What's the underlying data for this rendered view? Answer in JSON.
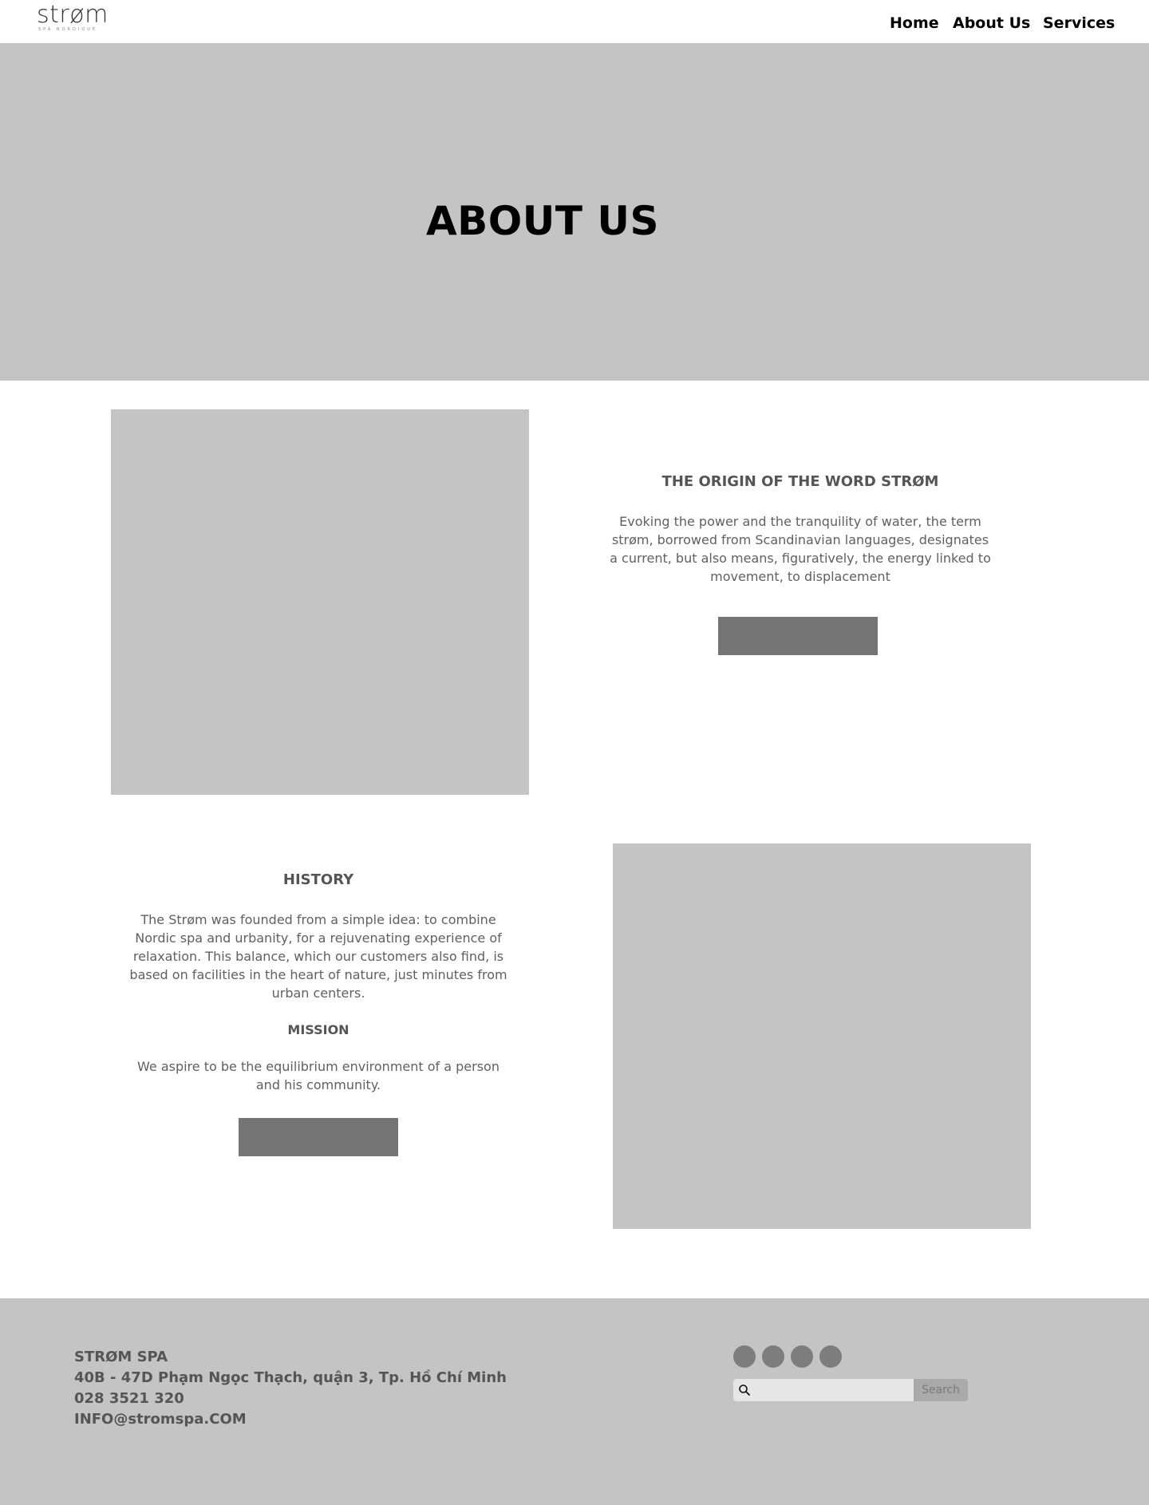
{
  "header": {
    "logo_word": "strøm",
    "logo_sub": "SPA NORDIQUE",
    "nav": {
      "home": "Home",
      "about": "About Us",
      "services": "Services"
    }
  },
  "hero": {
    "title": "ABOUT US"
  },
  "origin": {
    "heading": "THE ORIGIN OF THE WORD STRØM",
    "text": "Evoking the power and the tranquility of water, the term strøm, borrowed from Scandinavian languages, designates a current, but also means, figuratively, the energy linked to movement, to displacement"
  },
  "history": {
    "heading": "HISTORY",
    "text": "The Strøm was founded from a simple idea: to combine Nordic spa and urbanity, for a rejuvenating experience of relaxation. This balance, which our customers also find, is based on facilities in the heart of nature, just minutes from urban centers.",
    "mission_heading": "MISSION",
    "mission_text": "We aspire to be the equilibrium environment of a person and his community."
  },
  "footer": {
    "name": "STRØM SPA",
    "address": "40B - 47D Phạm Ngọc Thạch, quận 3, Tp. Hồ Chí Minh",
    "phone": "028 3521 320",
    "email": "INFO@stromspa.COM",
    "search_placeholder": "",
    "search_button": "Search"
  },
  "colors": {
    "placeholder_gray": "#c4c4c4",
    "button_gray": "#747474",
    "social_dot": "#7d7d7d"
  },
  "icons": {
    "search": "search-icon",
    "social": [
      "social-icon-1",
      "social-icon-2",
      "social-icon-3",
      "social-icon-4"
    ]
  }
}
